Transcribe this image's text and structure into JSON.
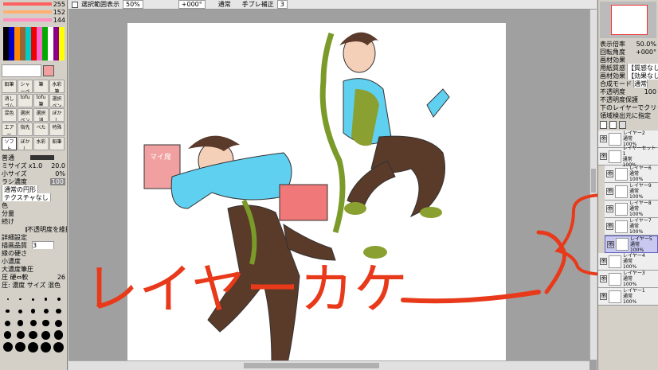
{
  "toolbar": {
    "check_label": "選択範囲表示",
    "zoom": "50%",
    "angle": "+000°",
    "mode": "通常",
    "stabilizer_label": "手ブレ補正",
    "stabilizer_value": "3"
  },
  "color": {
    "sliders": [
      {
        "value": "255",
        "color": "#ff6060"
      },
      {
        "value": "152",
        "color": "#ffb070"
      },
      {
        "value": "144",
        "color": "#ff90c0"
      }
    ],
    "primary": "#f0a0a0"
  },
  "brush": {
    "tools": [
      "鉛筆",
      "シャーペン",
      "筆",
      "水彩筆",
      "消しゴム",
      "tofu",
      "tofu筆",
      "選択ペン",
      "混色",
      "選択ペン",
      "選択消",
      "ぼかし",
      "エアー",
      "指先",
      "べた",
      "特殊",
      "ソフト",
      "ぼかし",
      "水彩",
      "鉛筆"
    ],
    "blend": "普通",
    "size_label": "ミサイズ",
    "size_mult": "x1.0",
    "size_value": "20.0",
    "min_size_label": "小サイズ",
    "min_size_value": "0%",
    "density_label": "ラシ濃度",
    "density_value": "100",
    "shape": "通常の円形",
    "texture": "テクスチャなし",
    "mix_label": "色",
    "amount_label": "分量",
    "persist_label": "続け",
    "keep_opacity": "不透明度を維持",
    "detail_label": "詳細設定",
    "quality_label": "描画品質",
    "quality_value": "3",
    "edge_label": "縁の硬さ",
    "min_density_label": "小濃度",
    "max_pressure_label": "大濃度筆圧",
    "pressure_label": "圧 硬⇔軟",
    "pressure_value": "26",
    "pressure_opts": "圧: 濃度 サイズ 混色",
    "size_presets": [
      "2.5",
      "3",
      "3.5",
      "4",
      "5",
      "6",
      "7",
      "8",
      "9",
      "10",
      "12",
      "14",
      "16",
      "20",
      "25",
      "30",
      "35",
      "40",
      "50",
      "60",
      "70",
      "80",
      "100",
      "120",
      "160"
    ]
  },
  "navigator": {
    "zoom_label": "表示倍率",
    "zoom_value": "50.0%",
    "rotate_label": "回転角度",
    "rotate_value": "+000°"
  },
  "layer_panel": {
    "effects_label": "画材効果",
    "paper_label": "用紙質感",
    "paper_value": "【質感なし】",
    "material_label": "画材効果",
    "material_value": "【効果なし】",
    "blend_label": "合成モード",
    "blend_value": "通常",
    "opacity_label": "不透明度",
    "opacity_value": "100",
    "protect_label": "不透明度保護",
    "clip_label": "下のレイヤーでクリッピング",
    "select_src_label": "領域検出元に指定",
    "layers": [
      {
        "name": "レイヤー2",
        "mode": "通常",
        "opacity": "100%"
      },
      {
        "name": "レイヤーセット1",
        "mode": "通常",
        "opacity": "100%"
      },
      {
        "name": "レイヤー6",
        "mode": "通常",
        "opacity": "100%"
      },
      {
        "name": "レイヤー9",
        "mode": "通常",
        "opacity": "100%"
      },
      {
        "name": "レイヤー8",
        "mode": "通常",
        "opacity": "100%"
      },
      {
        "name": "レイヤー7",
        "mode": "通常",
        "opacity": "100%"
      },
      {
        "name": "レイヤー5",
        "mode": "通常",
        "opacity": "100%"
      },
      {
        "name": "レイヤー4",
        "mode": "通常",
        "opacity": "100%"
      },
      {
        "name": "レイヤー3",
        "mode": "通常",
        "opacity": "100%"
      },
      {
        "name": "レイヤー1",
        "mode": "通常",
        "opacity": "100%"
      }
    ]
  },
  "canvas": {
    "annotation": "レイヤーカケ",
    "sign_text": "マイ席"
  }
}
